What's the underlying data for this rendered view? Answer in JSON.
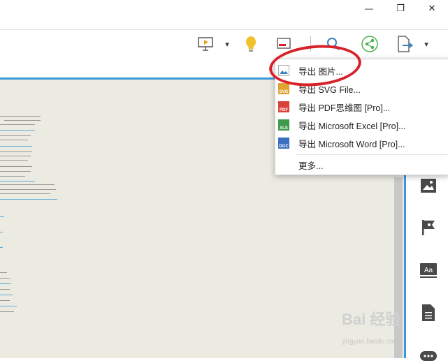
{
  "window": {
    "minimize": "—",
    "maximize": "❐",
    "close": "✕"
  },
  "toolbar": {
    "dropdown_arrow": "▾"
  },
  "export_menu": {
    "items": [
      {
        "label": "导出 图片...",
        "icon": "image-file-icon",
        "icon_text": ""
      },
      {
        "label": "导出 SVG File...",
        "icon": "svg-file-icon",
        "icon_text": "SVG"
      },
      {
        "label": "导出 PDF思维图 [Pro]...",
        "icon": "pdf-file-icon",
        "icon_text": "PDF"
      },
      {
        "label": "导出 Microsoft Excel [Pro]...",
        "icon": "excel-file-icon",
        "icon_text": "XLS"
      },
      {
        "label": "导出 Microsoft Word [Pro]...",
        "icon": "word-file-icon",
        "icon_text": "DOC"
      },
      {
        "label": "更多...",
        "icon": "",
        "icon_text": ""
      }
    ]
  },
  "watermark": {
    "brand": "Bai 经验",
    "url": "jingyan.baidu.com"
  },
  "colors": {
    "accent": "#3a9ad8",
    "highlight_circle": "#d8222a",
    "canvas_bg": "#ecebe2"
  }
}
